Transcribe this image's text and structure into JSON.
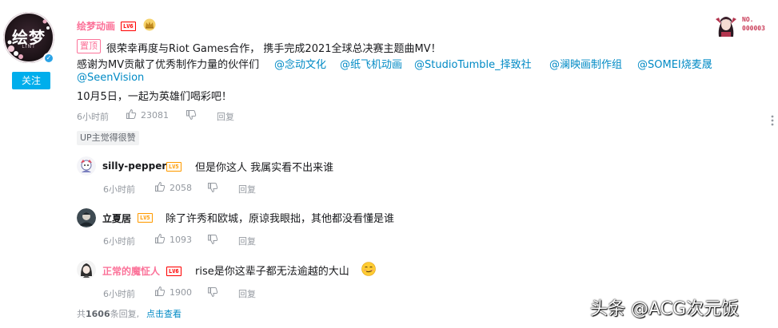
{
  "poster": {
    "avatar_text": "绘梦",
    "avatar_subtext": "LINT",
    "name": "绘梦动画",
    "level": "LV6",
    "follow_label": "关注",
    "rank_label_line1": "NO.",
    "rank_label_line2": "000003",
    "pin_label": "置顶",
    "content_line1": "很荣幸再度与Riot Games合作， 携手完成2021全球总决赛主题曲MV！",
    "content_line2_prefix": "感谢为MV贡献了优秀制作力量的伙伴们",
    "mentions_line2": [
      "@念动文化",
      "@纸飞机动画",
      "@StudioTumble_择致社",
      "@澜映画制作组",
      "@SOMEI烧麦晟"
    ],
    "mention_line3": "@SeenVision",
    "content_line4": "10月5日，一起为英雄们喝彩吧！",
    "time": "6小时前",
    "likes": "23081",
    "reply_label": "回复",
    "up_liked_label": "UP主觉得很赞"
  },
  "replies": [
    {
      "name": "silly-pepper",
      "level": "LV5",
      "text": "但是你这人 我属实看不出来谁",
      "time": "6小时前",
      "likes": "2058",
      "reply_label": "回复"
    },
    {
      "name": "立夏居",
      "level": "LV5",
      "text": "除了许秀和欧城，原谅我眼拙，其他都没看懂是谁",
      "time": "6小时前",
      "likes": "1093",
      "reply_label": "回复"
    },
    {
      "name": "正常的魔怔人",
      "level": "LV6",
      "text": "rise是你这辈子都无法逾越的大山",
      "time": "6小时前",
      "likes": "1900",
      "reply_label": "回复"
    }
  ],
  "footer": {
    "total_prefix": "共",
    "total_count": "1606",
    "total_suffix": "条回复,",
    "view_label": "点击查看"
  },
  "watermark": "头条 @ACG次元饭",
  "colors": {
    "accent_blue": "#00aeec",
    "link_blue": "#008ac5",
    "vip_pink": "#fb7299",
    "meta_gray": "#9499a0"
  },
  "icons": [
    "crown-icon",
    "verified-icon",
    "thumbs-up-icon",
    "thumbs-down-icon",
    "more-vertical-icon",
    "smirk-emoji-icon"
  ]
}
